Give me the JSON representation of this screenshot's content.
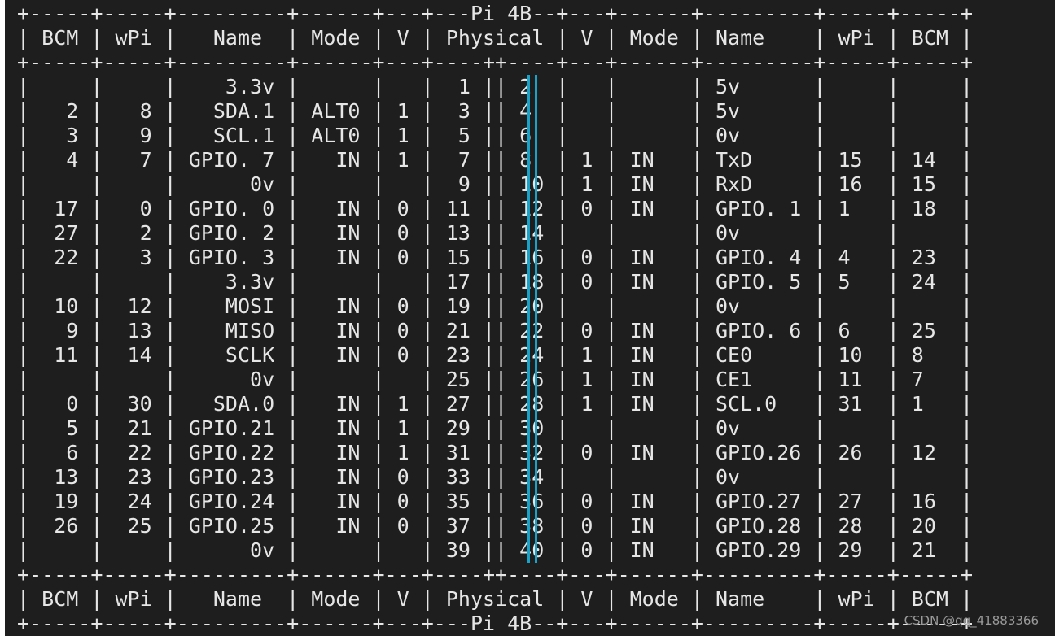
{
  "header_lines": [
    " +-----+-----+---------+------+---+---Pi 4B--+---+------+---------+-----+-----+",
    " | BCM | wPi |   Name  | Mode | V | Physical | V | Mode | Name    | wPi | BCM |",
    " +-----+-----+---------+------+---+----++----+---+------+---------+-----+-----+"
  ],
  "rows": [
    " |     |     |    3.3v |      |   |  1 || 2  |   |      | 5v      |     |     |",
    " |   2 |   8 |   SDA.1 | ALT0 | 1 |  3 || 4  |   |      | 5v      |     |     |",
    " |   3 |   9 |   SCL.1 | ALT0 | 1 |  5 || 6  |   |      | 0v      |     |     |",
    " |   4 |   7 | GPIO. 7 |   IN | 1 |  7 || 8  | 1 | IN   | TxD     | 15  | 14  |",
    " |     |     |      0v |      |   |  9 || 10 | 1 | IN   | RxD     | 16  | 15  |",
    " |  17 |   0 | GPIO. 0 |   IN | 0 | 11 || 12 | 0 | IN   | GPIO. 1 | 1   | 18  |",
    " |  27 |   2 | GPIO. 2 |   IN | 0 | 13 || 14 |   |      | 0v      |     |     |",
    " |  22 |   3 | GPIO. 3 |   IN | 0 | 15 || 16 | 0 | IN   | GPIO. 4 | 4   | 23  |",
    " |     |     |    3.3v |      |   | 17 || 18 | 0 | IN   | GPIO. 5 | 5   | 24  |",
    " |  10 |  12 |    MOSI |   IN | 0 | 19 || 20 |   |      | 0v      |     |     |",
    " |   9 |  13 |    MISO |   IN | 0 | 21 || 22 | 0 | IN   | GPIO. 6 | 6   | 25  |",
    " |  11 |  14 |    SCLK |   IN | 0 | 23 || 24 | 1 | IN   | CE0     | 10  | 8   |",
    " |     |     |      0v |      |   | 25 || 26 | 1 | IN   | CE1     | 11  | 7   |",
    " |   0 |  30 |   SDA.0 |   IN | 1 | 27 || 28 | 1 | IN   | SCL.0   | 31  | 1   |",
    " |   5 |  21 | GPIO.21 |   IN | 1 | 29 || 30 |   |      | 0v      |     |     |",
    " |   6 |  22 | GPIO.22 |   IN | 1 | 31 || 32 | 0 | IN   | GPIO.26 | 26  | 12  |",
    " |  13 |  23 | GPIO.23 |   IN | 0 | 33 || 34 |   |      | 0v      |     |     |",
    " |  19 |  24 | GPIO.24 |   IN | 0 | 35 || 36 | 0 | IN   | GPIO.27 | 27  | 16  |",
    " |  26 |  25 | GPIO.25 |   IN | 0 | 37 || 38 | 0 | IN   | GPIO.28 | 28  | 20  |",
    " |     |     |      0v |      |   | 39 || 40 | 0 | IN   | GPIO.29 | 29  | 21  |"
  ],
  "footer_lines": [
    " +-----+-----+---------+------+---+----++----+---+------+---------+-----+-----+",
    " | BCM | wPi |   Name  | Mode | V | Physical | V | Mode | Name    | wPi | BCM |",
    " +-----+-----+---------+------+---+---Pi 4B--+---+------+---------+-----+-----+"
  ],
  "watermark": "CSDN @qq_41883366",
  "colors": {
    "terminal_bg": "#1e1e1e",
    "text": "#e6e6e6",
    "pipe_accent": "#1aa3c9"
  }
}
